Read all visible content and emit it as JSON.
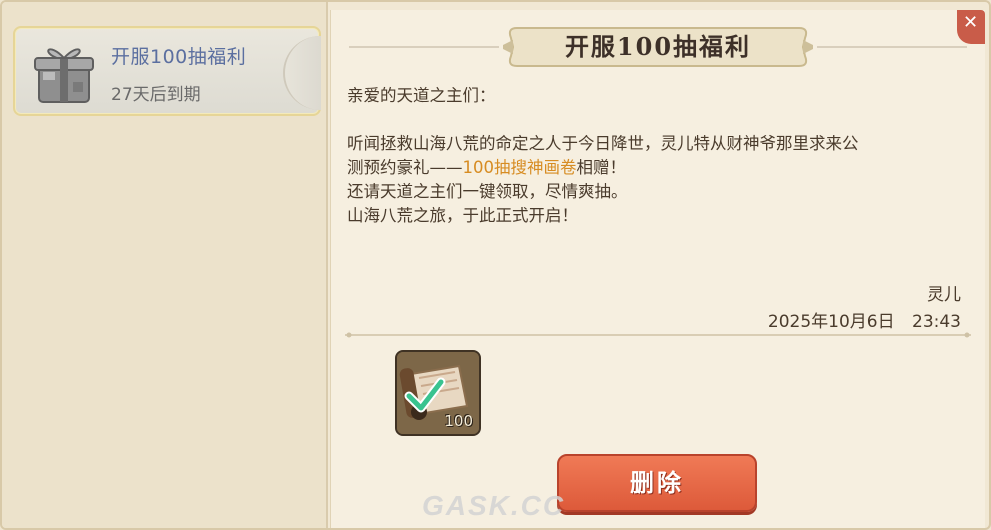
{
  "sidebar": {
    "items": [
      {
        "title": "开服100抽福利",
        "expire": "27天后到期"
      }
    ]
  },
  "mail": {
    "banner_title": "开服100抽福利",
    "greeting": "亲爱的天道之主们：",
    "line1": "听闻拯救山海八荒的命定之人于今日降世，灵儿特从财神爷那里求来公",
    "line2_pre": "测预约豪礼——",
    "line2_highlight": "100抽搜神画卷",
    "line2_post": "相赠！",
    "line3": "还请天道之主们一键领取，尽情爽抽。",
    "line4": "山海八荒之旅，于此正式开启！",
    "signature": "灵儿",
    "date": "2025年10月6日 23:43"
  },
  "attachment": {
    "icon": "scroll-icon",
    "count": "100",
    "claimed": true
  },
  "actions": {
    "delete_label": "删除"
  },
  "watermark": "GASK.CC",
  "colors": {
    "highlight": "#d78c22",
    "delete_button": "#e4633f",
    "selected_title": "#5b6fa0"
  }
}
